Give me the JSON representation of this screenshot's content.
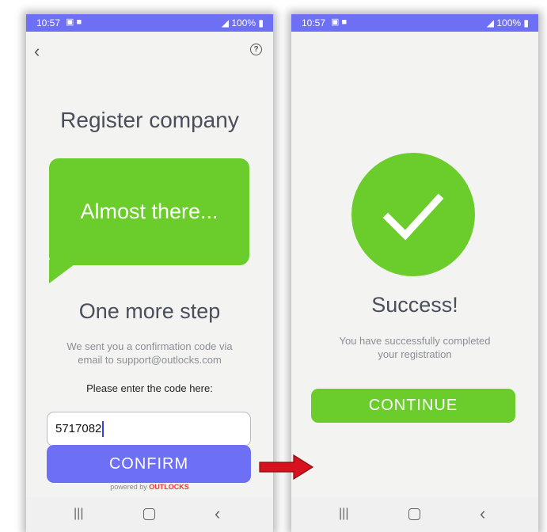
{
  "status_bar": {
    "time": "10:57",
    "battery": "100%"
  },
  "left_screen": {
    "title": "Register company",
    "bubble_text": "Almost there...",
    "subheading": "One more step",
    "info_line1": "We sent you a confirmation code via",
    "info_line2": "email to support@outlocks.com",
    "prompt": "Please enter the code here:",
    "code_value": "5717082",
    "confirm_label": "CONFIRM",
    "powered_by": "powered by",
    "brand": "OUTLOCKS"
  },
  "right_screen": {
    "title": "Success!",
    "message_line1": "You have successfully completed",
    "message_line2": "your registration",
    "continue_label": "CONTINUE"
  },
  "icons": {
    "back": "chevron-left-icon",
    "help": "question-circle-icon",
    "check": "check-icon",
    "arrow": "arrow-right-icon"
  },
  "colors": {
    "status_bar": "#6d6ff4",
    "accent_green": "#6acd2b",
    "confirm_button": "#6d6ff4",
    "brand_red": "#e53935",
    "arrow_red": "#d6121f"
  }
}
